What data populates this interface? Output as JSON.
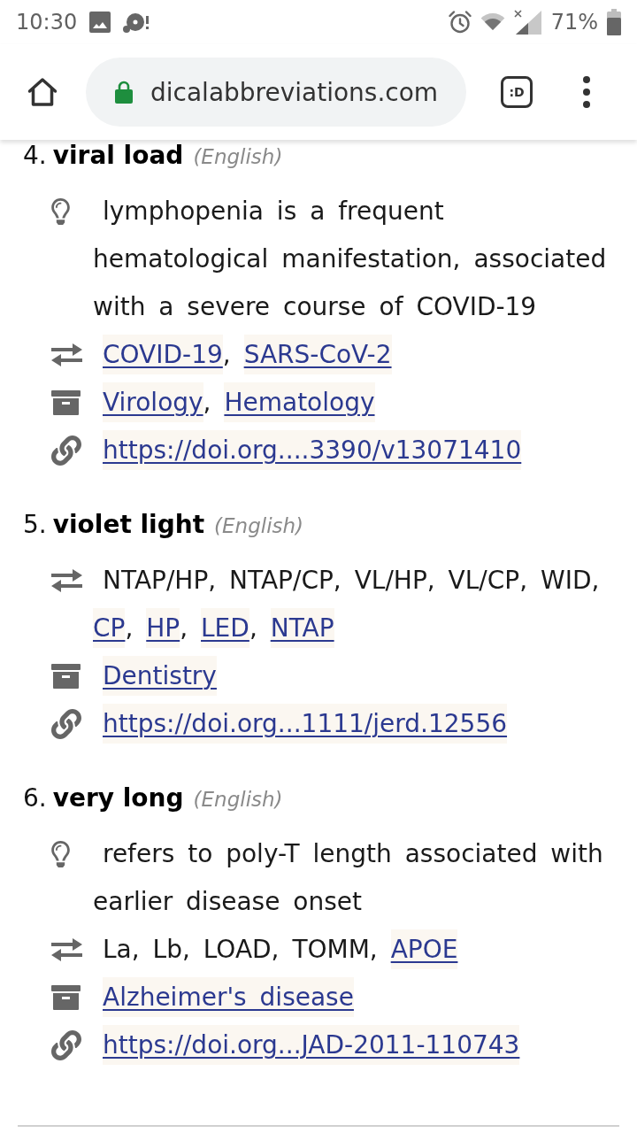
{
  "status_bar": {
    "time": "10:30",
    "battery": "71%"
  },
  "toolbar": {
    "url": "dicalabbreviations.com",
    "tab_count": ":D"
  },
  "entries": [
    {
      "number": "4.",
      "term": "viral load",
      "language": "(English)",
      "rows": [
        {
          "kind": "note",
          "parts": [
            {
              "text": "lymphopenia is a frequent hematological manifestation, associated with a severe course of COVID-19",
              "link": false
            }
          ]
        },
        {
          "kind": "synonyms",
          "parts": [
            {
              "text": "COVID-19",
              "link": true
            },
            {
              "text": ", ",
              "link": false
            },
            {
              "text": "SARS-CoV-2",
              "link": true
            }
          ]
        },
        {
          "kind": "categories",
          "parts": [
            {
              "text": "Virology",
              "link": true
            },
            {
              "text": ", ",
              "link": false
            },
            {
              "text": "Hematology",
              "link": true
            }
          ]
        },
        {
          "kind": "source",
          "parts": [
            {
              "text": "https://doi.org....3390/v13071410",
              "link": true
            }
          ]
        }
      ]
    },
    {
      "number": "5.",
      "term": "violet light",
      "language": "(English)",
      "rows": [
        {
          "kind": "synonyms",
          "parts": [
            {
              "text": "NTAP/HP, NTAP/CP, VL/HP, VL/CP, WID, ",
              "link": false
            },
            {
              "text": "CP",
              "link": true
            },
            {
              "text": ", ",
              "link": false
            },
            {
              "text": "HP",
              "link": true
            },
            {
              "text": ", ",
              "link": false
            },
            {
              "text": "LED",
              "link": true
            },
            {
              "text": ", ",
              "link": false
            },
            {
              "text": "NTAP",
              "link": true
            }
          ]
        },
        {
          "kind": "categories",
          "parts": [
            {
              "text": "Dentistry",
              "link": true
            }
          ]
        },
        {
          "kind": "source",
          "parts": [
            {
              "text": "https://doi.org...1111/jerd.12556",
              "link": true
            }
          ]
        }
      ]
    },
    {
      "number": "6.",
      "term": "very long",
      "language": "(English)",
      "rows": [
        {
          "kind": "note",
          "parts": [
            {
              "text": "refers to poly-T length associated with earlier disease onset",
              "link": false
            }
          ]
        },
        {
          "kind": "synonyms",
          "parts": [
            {
              "text": "La, Lb, LOAD, TOMM, ",
              "link": false
            },
            {
              "text": "APOE",
              "link": true
            }
          ]
        },
        {
          "kind": "categories",
          "parts": [
            {
              "text": "Alzheimer's disease",
              "link": true
            }
          ]
        },
        {
          "kind": "source",
          "parts": [
            {
              "text": "https://doi.org...JAD-2011-110743",
              "link": true
            }
          ]
        }
      ]
    }
  ]
}
